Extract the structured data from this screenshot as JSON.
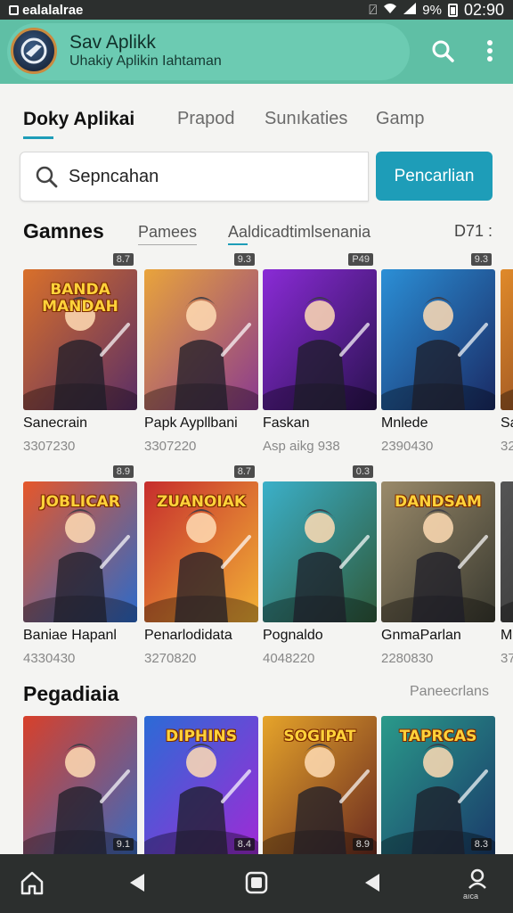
{
  "status_bar": {
    "left_text": "ealalalrae",
    "battery": "9%",
    "time": "02:90"
  },
  "header": {
    "title": "Sav Aplikk",
    "subtitle": "Uhakiy Aplikin Iahtaman"
  },
  "tabs": [
    {
      "label": "Doky Aplikai"
    },
    {
      "label": "Prapod"
    },
    {
      "label": "Sunıkaties"
    },
    {
      "label": "Gamp"
    }
  ],
  "search": {
    "value": "Sepncahan",
    "button_label": "Pencarlian"
  },
  "games_section": {
    "title": "Gamnes",
    "filters": [
      "Pamees",
      "Aaldicadtimlsenania"
    ],
    "more": "D71 :"
  },
  "games_row1": [
    {
      "name": "Sanecrain",
      "meta": "3307230",
      "badge": "8.7",
      "art": "BANDA MANDAH",
      "colors": [
        "#d9702a",
        "#5a2e66"
      ]
    },
    {
      "name": "Papk Aypllbani",
      "meta": "3307220",
      "badge": "9.3",
      "art": "",
      "colors": [
        "#e9a43b",
        "#8a3a8f"
      ]
    },
    {
      "name": "Faskan",
      "meta": "Asp aikg 938",
      "badge": "P49",
      "art": "",
      "colors": [
        "#8a2bd6",
        "#2a1250"
      ]
    },
    {
      "name": "Mnlede",
      "meta": "2390430",
      "badge": "9.3",
      "art": "",
      "colors": [
        "#2b8fd6",
        "#1a2a64"
      ]
    },
    {
      "name": "Sa",
      "meta": "32",
      "badge": "",
      "art": "",
      "colors": [
        "#e08a2a",
        "#7a3a20"
      ]
    }
  ],
  "games_row2": [
    {
      "name": "Baniae Hapanl",
      "meta": "4330430",
      "badge": "8.9",
      "art": "JOBLICAR",
      "colors": [
        "#e6572a",
        "#2a6acb"
      ]
    },
    {
      "name": "Penarlodidata",
      "meta": "3270820",
      "badge": "8.7",
      "art": "ZUANOIAK",
      "colors": [
        "#c62d2d",
        "#f2b236"
      ]
    },
    {
      "name": "Pognaldo",
      "meta": "4048220",
      "badge": "0.3",
      "art": "",
      "colors": [
        "#3bb0c9",
        "#2f5a3a"
      ]
    },
    {
      "name": "GnmaParlan",
      "meta": "2280830",
      "badge": "",
      "art": "DANDSAM",
      "colors": [
        "#9a8a6a",
        "#3a3a30"
      ]
    },
    {
      "name": "M",
      "meta": "37",
      "badge": "",
      "art": "",
      "colors": [
        "#555",
        "#333"
      ]
    }
  ],
  "popular_section": {
    "title": "Pegadiaia",
    "link": "Paneecrlans"
  },
  "games_row3": [
    {
      "name": "",
      "meta": "",
      "badge": "9.1",
      "art": "",
      "colors": [
        "#d8402a",
        "#3a6ac0"
      ]
    },
    {
      "name": "",
      "meta": "",
      "badge": "8.4",
      "art": "DIPHINS",
      "colors": [
        "#2b6bd6",
        "#a02ad6"
      ]
    },
    {
      "name": "",
      "meta": "",
      "badge": "8.9",
      "art": "SOGIPAT",
      "colors": [
        "#e6a42a",
        "#6a2a20"
      ]
    },
    {
      "name": "",
      "meta": "",
      "badge": "8.3",
      "art": "TAPRCAS",
      "colors": [
        "#2a9a8a",
        "#1a3a6a"
      ]
    }
  ],
  "nav": {
    "profile_label": "aıca"
  },
  "colors": {
    "accent": "#1e9db8",
    "header": "#5fbfa5"
  }
}
